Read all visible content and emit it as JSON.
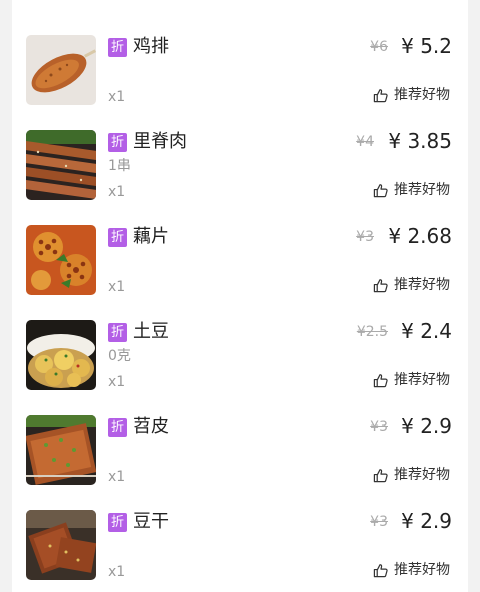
{
  "items": [
    {
      "tag": "折",
      "name": "鸡排",
      "spec": "",
      "qty": "x1",
      "old_price": "¥6",
      "price": "¥ 5.2",
      "recommend": "推荐好物",
      "image": "fried-chicken-cutlet"
    },
    {
      "tag": "折",
      "name": "里脊肉",
      "spec": "1串",
      "qty": "x1",
      "old_price": "¥4",
      "price": "¥ 3.85",
      "recommend": "推荐好物",
      "image": "grilled-tenderloin-skewers"
    },
    {
      "tag": "折",
      "name": "藕片",
      "spec": "",
      "qty": "x1",
      "old_price": "¥3",
      "price": "¥ 2.68",
      "recommend": "推荐好物",
      "image": "lotus-root-slices"
    },
    {
      "tag": "折",
      "name": "土豆",
      "spec": "0克",
      "qty": "x1",
      "old_price": "¥2.5",
      "price": "¥ 2.4",
      "recommend": "推荐好物",
      "image": "roasted-potatoes"
    },
    {
      "tag": "折",
      "name": "苕皮",
      "spec": "",
      "qty": "x1",
      "old_price": "¥3",
      "price": "¥ 2.9",
      "recommend": "推荐好物",
      "image": "grilled-sweet-potato-sheet"
    },
    {
      "tag": "折",
      "name": "豆干",
      "spec": "",
      "qty": "x1",
      "old_price": "¥3",
      "price": "¥ 2.9",
      "recommend": "推荐好物",
      "image": "grilled-dried-tofu"
    }
  ],
  "icons": {
    "recommend": "thumbs-up-icon"
  },
  "colors": {
    "tag_bg": "#b35fe6",
    "text": "#222222",
    "muted": "#999999",
    "strike": "#aaaaaa",
    "background": "#f2f2f2"
  }
}
